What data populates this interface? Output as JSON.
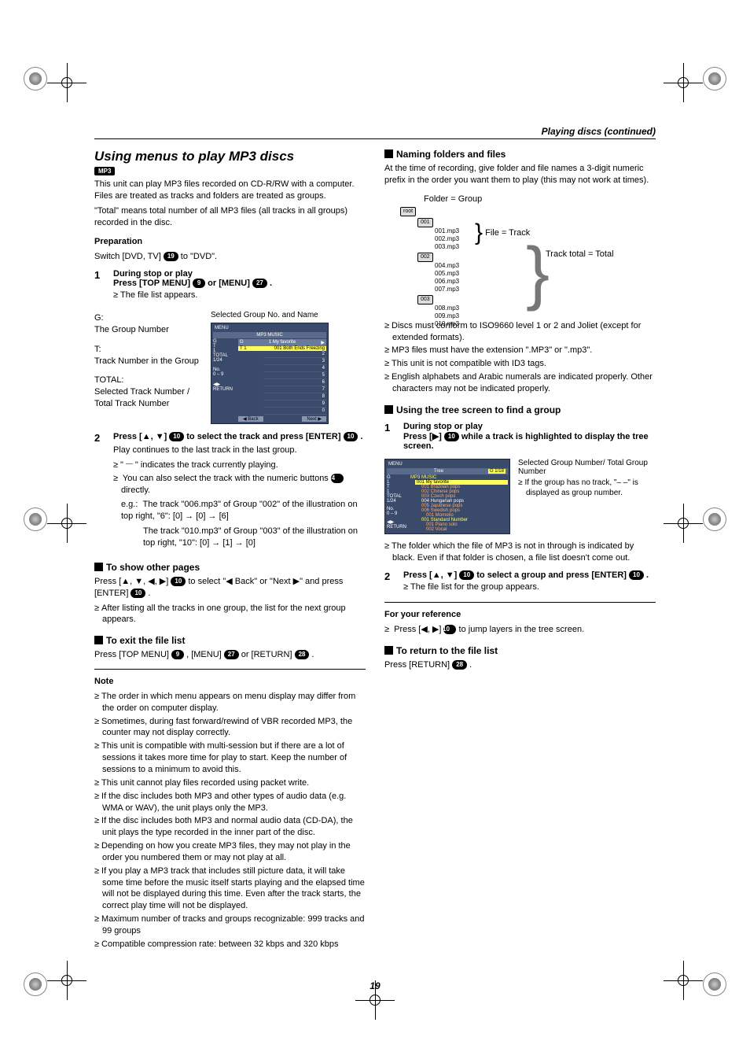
{
  "header": {
    "section_title": "Playing discs (continued)"
  },
  "page_number": "19",
  "left": {
    "title": "Using menus to play MP3 discs",
    "format_badge": "MP3",
    "intro": [
      "This unit can play MP3 files recorded on CD-R/RW with a computer. Files are treated as tracks and folders are treated as groups.",
      "\"Total\" means total number of all MP3 files (all tracks in all groups) recorded in the disc."
    ],
    "prep_heading": "Preparation",
    "prep_line_a": "Switch [DVD, TV] ",
    "prep_pill": "19",
    "prep_line_b": " to \"DVD\".",
    "step1": {
      "num": "1",
      "context": "During stop or play",
      "action_a": "Press [TOP MENU] ",
      "pill_a": "9",
      "action_mid": " or [MENU] ",
      "pill_b": "27",
      "action_end": ".",
      "note": "The file list appears."
    },
    "legend": {
      "g_label": "G:",
      "g_desc": "The Group Number",
      "t_label": "T:",
      "t_desc": "Track Number in the Group",
      "total_label": "TOTAL:",
      "total_desc": "Selected Track Number / Total Track Number",
      "caption": "Selected Group No. and Name"
    },
    "menushot": {
      "menu_label": "MENU",
      "title_center": "MP3 MUSIC",
      "group_line_a": "G",
      "group_line_b": "1  My favorite",
      "hl_row_left": "T  1",
      "hl_row_right": "001 Both Ends Freezing",
      "total": "1/24",
      "return_label": "RETURN",
      "no_label": "No.",
      "back": "◀ Back",
      "next": "Next ▶"
    },
    "step2": {
      "num": "2",
      "action_a": "Press [▲, ▼] ",
      "pill_a": "10",
      "action_b": " to select the track and press [ENTER] ",
      "pill_b": "10",
      "action_end": ".",
      "line1": "Play continues to the last track in the last group.",
      "bul1": "\" 𝄖 \" indicates the track currently playing.",
      "bul2a": "You can also select the track with the numeric buttons ",
      "bul2_pill": "4",
      "bul2b": " directly.",
      "eg_label": "e.g.:",
      "eg1": "The track \"006.mp3\" of Group \"002\" of the illustration on top right,    \"6\":   [0] → [0] → [6]",
      "eg2": "The track \"010.mp3\" of Group \"003\" of the illustration on top right,    \"10\":  [0] → [1] → [0]"
    },
    "show_other": {
      "heading": "To show other pages",
      "line_a": "Press [▲, ▼, ◀, ▶] ",
      "pill_a": "10",
      "line_b": " to select \"◀ Back\" or \"Next ▶\" and press [ENTER] ",
      "pill_b": "10",
      "line_end": ".",
      "bul": "After listing all the tracks in one group, the list for the next group appears."
    },
    "exit": {
      "heading": "To exit the file list",
      "line_a": "Press [TOP MENU] ",
      "pill_a": "9",
      "line_b": ", [MENU] ",
      "pill_b": "27",
      "line_c": " or [RETURN] ",
      "pill_c": "28",
      "line_end": "."
    },
    "note_heading": "Note",
    "notes": [
      "The order in which menu appears on menu display may differ from the order on computer display.",
      "Sometimes, during fast forward/rewind of VBR recorded MP3, the counter may not display correctly.",
      "This unit is compatible with multi-session but if there are a lot of sessions it takes more time for play to start. Keep the number of sessions to a minimum to avoid this.",
      "This unit cannot play files recorded using packet write.",
      "If the disc includes both MP3 and other types of audio data (e.g. WMA or WAV), the unit plays only the MP3.",
      "If the disc includes both MP3 and normal audio data (CD-DA), the unit plays the type recorded in the inner part of the disc.",
      "Depending on how you create MP3 files, they may not play in the order you numbered them or may not play at all.",
      "If you play a MP3 track that includes still picture data, it will take some time before the music itself starts playing and the elapsed time will not be displayed during this time. Even after the track starts, the correct play time will not be displayed.",
      "Maximum number of tracks and groups recognizable: 999 tracks and 99 groups",
      "Compatible compression rate: between 32 kbps and 320 kbps"
    ]
  },
  "right": {
    "naming": {
      "heading": "Naming folders and files",
      "para": "At the time of recording, give folder and file names a 3-digit numeric prefix in the order you want them to play (this may not work at times).",
      "folder_group": "Folder = Group",
      "file_track": "File = Track",
      "track_total": "Track total = Total",
      "root": "root",
      "f001": "001",
      "f002": "002",
      "f003": "003",
      "t001": "001.mp3",
      "t002": "002.mp3",
      "t003": "003.mp3",
      "t004": "004.mp3",
      "t005": "005.mp3",
      "t006": "006.mp3",
      "t007": "007.mp3",
      "t008": "008.mp3",
      "t009": "009.mp3",
      "t010": "010.mp3"
    },
    "naming_notes": [
      "Discs must conform to ISO9660 level 1 or 2 and Joliet (except for extended formats).",
      "MP3 files must have the extension \".MP3\" or \".mp3\".",
      "This unit is not compatible with ID3 tags.",
      "English alphabets and Arabic numerals are indicated properly. Other characters may not be indicated properly."
    ],
    "tree": {
      "heading": "Using the tree screen to find a group",
      "step1": {
        "num": "1",
        "context": "During stop or play",
        "action_a": "Press [▶] ",
        "pill": "10",
        "action_b": " while a track is highlighted to display the tree screen."
      },
      "caption_line1": "Selected Group Number/ Total Group Number",
      "caption_bul": "If the group has no track, \"– –\" is displayed as group number.",
      "below_bul": "The folder which the file of MP3 is not in through is indicated by black. Even if that folder is chosen, a file list doesn't come out.",
      "step2": {
        "num": "2",
        "action_a": "Press [▲, ▼] ",
        "pill_a": "10",
        "action_b": " to select a group and press [ENTER] ",
        "pill_b": "10",
        "action_end": ".",
        "note": "The file list for the group appears."
      }
    },
    "treeshot": {
      "menu_label": "MENU",
      "title_center": "Tree",
      "counter": "G    1/18",
      "root": "MP3 MUSIC",
      "sel": "001 My favorite",
      "items": [
        "001 Brazilian pops",
        "002 Chinese pops",
        "003 Czech pops",
        "004 Hungarian pops",
        "005 Japanese pops",
        "006 Swedish pops",
        "001 Momoko",
        "001 Standard Number",
        "001 Piano solo",
        "002 Vocal"
      ],
      "g": "G",
      "t": "T",
      "total": "TOTAL",
      "total_val": "1/24",
      "no": "No.",
      "ret": "RETURN"
    },
    "ref": {
      "heading": "For your reference",
      "line_a": "Press [◀, ▶] ",
      "pill": "10",
      "line_b": " to jump layers in the tree screen."
    },
    "return": {
      "heading": "To return to the file list",
      "line_a": "Press [RETURN] ",
      "pill": "28",
      "line_end": "."
    }
  }
}
